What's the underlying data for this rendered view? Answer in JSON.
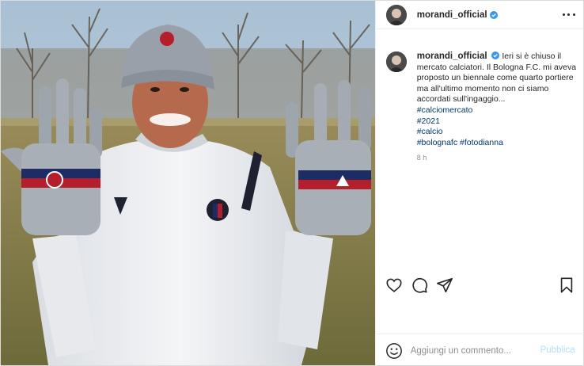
{
  "post": {
    "username": "morandi_official",
    "verified": true,
    "caption": "Ieri si è chiuso il mercato calciatori. Il Bologna F.C. mi aveva proposto un biennale come quarto portiere ma all'ultimo momento non ci siamo accordati sull'ingaggio...",
    "hashtags": [
      "#calciomercato",
      "#2021",
      "#calcio"
    ],
    "hashtag_row": [
      "#bolognafc",
      "#fotodianna"
    ],
    "time": "8 h"
  },
  "actions": {
    "icons": [
      "heart-icon",
      "comment-icon",
      "share-icon",
      "bookmark-icon"
    ]
  },
  "comment": {
    "placeholder": "Aggiungi un commento...",
    "publish_label": "Pubblica"
  },
  "colors": {
    "link": "#00376b",
    "verified": "#3897f0",
    "publish_disabled": "#b2dffc",
    "muted": "#8e8e8e"
  }
}
